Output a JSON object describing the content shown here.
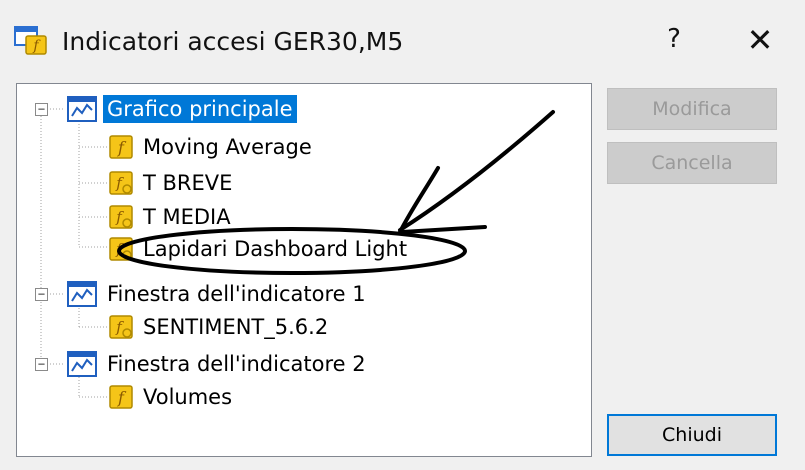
{
  "window": {
    "title": "Indicatori accesi GER30,M5",
    "help_label": "?",
    "close_label": "✕"
  },
  "tree": {
    "groups": [
      {
        "label": "Grafico principale",
        "expander": "−",
        "icon": "chart-window-icon",
        "selected": true,
        "children": [
          {
            "label": "Moving Average",
            "icon": "function-icon"
          },
          {
            "label": "T BREVE",
            "icon": "custom-function-icon"
          },
          {
            "label": "T MEDIA",
            "icon": "custom-function-icon"
          },
          {
            "label": "Lapidari Dashboard Light",
            "icon": "custom-function-icon"
          }
        ]
      },
      {
        "label": "Finestra dell'indicatore 1",
        "expander": "−",
        "icon": "chart-window-icon",
        "children": [
          {
            "label": "SENTIMENT_5.6.2",
            "icon": "custom-function-icon"
          }
        ]
      },
      {
        "label": "Finestra dell'indicatore 2",
        "expander": "−",
        "icon": "chart-window-icon",
        "children": [
          {
            "label": "Volumes",
            "icon": "function-icon"
          }
        ]
      }
    ]
  },
  "buttons": {
    "modify": "Modifica",
    "delete": "Cancella",
    "close": "Chiudi"
  },
  "colors": {
    "selection": "#0078d7",
    "icon_yellow": "#f5c518",
    "icon_blue": "#1f5fbf"
  }
}
